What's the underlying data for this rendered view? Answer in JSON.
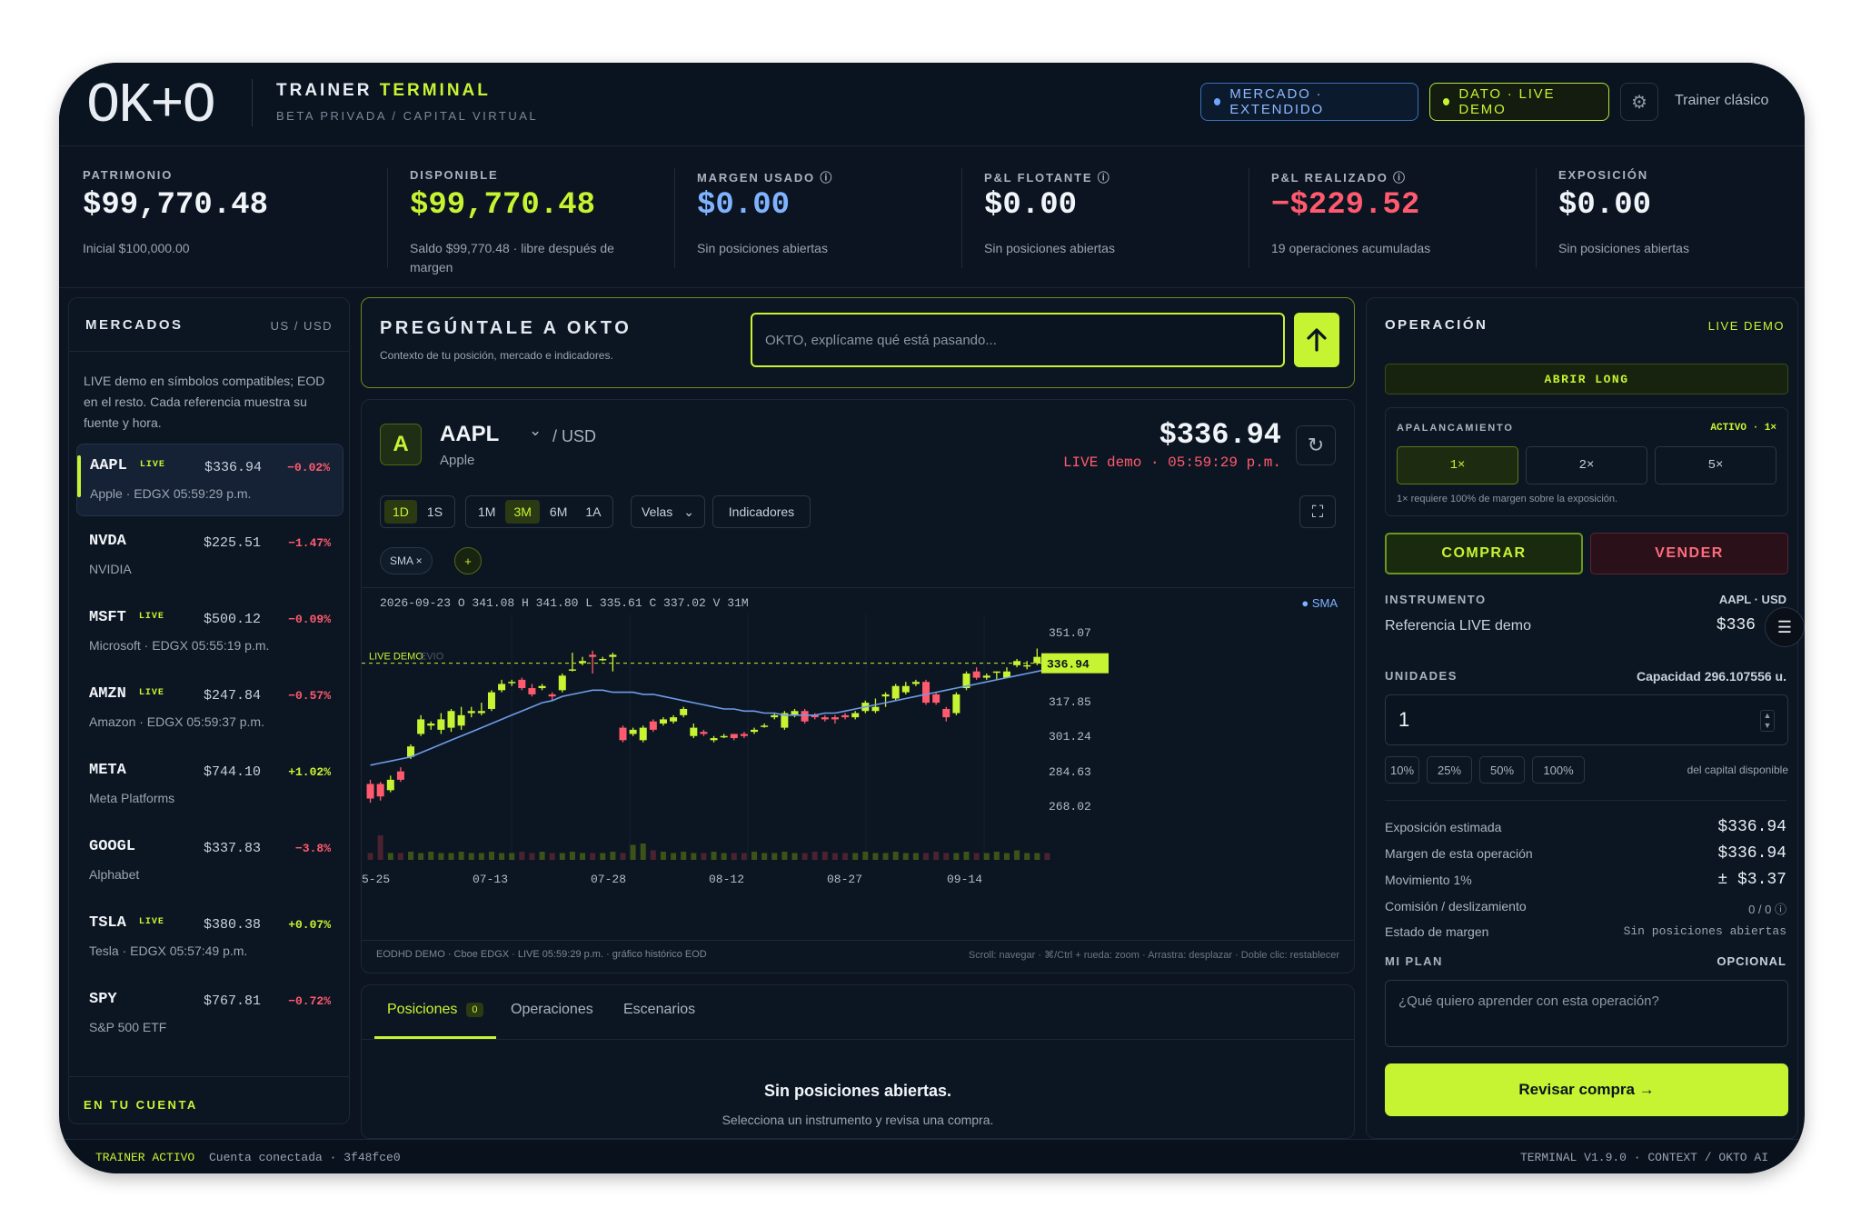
{
  "header": {
    "logo": "OK+O",
    "brand_a": "TRAINER",
    "brand_b": "TERMINAL",
    "subtitle": "BETA PRIVADA / CAPITAL VIRTUAL",
    "market_pill": "MERCADO · EXTENDIDO",
    "data_pill": "DATO · LIVE DEMO",
    "trainer_link": "Trainer clásico"
  },
  "stats": [
    {
      "label": "PATRIMONIO",
      "value": "$99,770.48",
      "sub": "Inicial $100,000.00",
      "color": "#f1f4f8"
    },
    {
      "label": "DISPONIBLE",
      "value": "$99,770.48",
      "sub": "Saldo $99,770.48 · libre después de margen",
      "color": "#c6f432"
    },
    {
      "label": "MARGEN USADO ⓘ",
      "value": "$0.00",
      "sub": "Sin posiciones abiertas",
      "color": "#7fb3ff"
    },
    {
      "label": "P&L FLOTANTE ⓘ",
      "value": "$0.00",
      "sub": "Sin posiciones abiertas",
      "color": "#f1f4f8"
    },
    {
      "label": "P&L REALIZADO ⓘ",
      "value": "−$229.52",
      "sub": "19 operaciones acumuladas",
      "color": "#ff5a6e"
    },
    {
      "label": "EXPOSICIÓN",
      "value": "$0.00",
      "sub": "Sin posiciones abiertas",
      "color": "#f1f4f8"
    }
  ],
  "markets": {
    "title": "MERCADOS",
    "region": "US / USD",
    "note": "LIVE demo en símbolos compatibles; EOD en el resto. Cada referencia muestra su fuente y hora.",
    "items": [
      {
        "symbol": "AAPL",
        "live": "LIVE",
        "price": "$336.94",
        "change": "−0.02%",
        "dir": "dn",
        "name": "Apple · EDGX 05:59:29 p.m."
      },
      {
        "symbol": "NVDA",
        "live": "",
        "price": "$225.51",
        "change": "−1.47%",
        "dir": "dn",
        "name": "NVIDIA"
      },
      {
        "symbol": "MSFT",
        "live": "LIVE",
        "price": "$500.12",
        "change": "−0.09%",
        "dir": "dn",
        "name": "Microsoft · EDGX 05:55:19 p.m."
      },
      {
        "symbol": "AMZN",
        "live": "LIVE",
        "price": "$247.84",
        "change": "−0.57%",
        "dir": "dn",
        "name": "Amazon · EDGX 05:59:37 p.m."
      },
      {
        "symbol": "META",
        "live": "",
        "price": "$744.10",
        "change": "+1.02%",
        "dir": "up",
        "name": "Meta Platforms"
      },
      {
        "symbol": "GOOGL",
        "live": "",
        "price": "$337.83",
        "change": "−3.8%",
        "dir": "dn",
        "name": "Alphabet"
      },
      {
        "symbol": "TSLA",
        "live": "LIVE",
        "price": "$380.38",
        "change": "+0.07%",
        "dir": "up",
        "name": "Tesla · EDGX 05:57:49 p.m."
      },
      {
        "symbol": "SPY",
        "live": "",
        "price": "$767.81",
        "change": "−0.72%",
        "dir": "dn",
        "name": "S&P 500 ETF"
      }
    ],
    "account_label": "EN TU CUENTA"
  },
  "ask": {
    "title": "PREGÚNTALE A OKTO",
    "subtitle": "Contexto de tu posición, mercado e indicadores.",
    "placeholder": "OKTO, explícame qué está pasando..."
  },
  "chart": {
    "badge": "A",
    "symbol": "AAPL",
    "currency": "/ USD",
    "company": "Apple",
    "price": "$336.94",
    "live_text": "LIVE demo · 05:59:29 p.m.",
    "ranges_a": [
      "1D",
      "1S"
    ],
    "ranges_b": [
      "1M",
      "3M",
      "6M",
      "1A"
    ],
    "active_range": "3M",
    "chart_style": "Velas",
    "indicators_label": "Indicadores",
    "sma_chip": "SMA ×",
    "add_chip": "+",
    "ohlc_readout": "2026-09-23 O 341.08 H 341.80 L 335.61 C 337.02 V 31M",
    "sma_legend": "● SMA",
    "live_line_label": "LIVE DEMO",
    "live_line_ghost": "EVIO",
    "price_tag": "336.94",
    "y_ticks": [
      "351.07",
      "317.85",
      "301.24",
      "284.63",
      "268.02"
    ],
    "x_ticks": [
      "5-25",
      "07-13",
      "07-28",
      "08-12",
      "08-27",
      "09-14"
    ],
    "source_note": "EODHD DEMO · Cboe EDGX · LIVE 05:59:29 p.m. · gráfico histórico EOD",
    "hint_note": "Scroll: navegar · ⌘/Ctrl + rueda: zoom · Arrastra: desplazar · Doble clic: restablecer"
  },
  "chart_data": {
    "type": "candlestick",
    "ylim": [
      260,
      356
    ],
    "y_ticks": [
      351.07,
      317.85,
      301.24,
      284.63,
      268.02
    ],
    "x_labels": [
      "5-25",
      "07-13",
      "07-28",
      "08-12",
      "08-27",
      "09-14"
    ],
    "live_price": 336.94,
    "candles": [
      [
        279,
        272,
        281,
        270
      ],
      [
        279,
        273,
        280,
        271
      ],
      [
        276,
        281,
        283,
        275
      ],
      [
        285,
        281,
        287,
        280
      ],
      [
        292,
        297,
        298,
        291
      ],
      [
        303,
        310,
        312,
        302
      ],
      [
        307,
        308,
        309,
        305
      ],
      [
        305,
        310,
        313,
        303
      ],
      [
        306,
        314,
        315,
        304
      ],
      [
        307,
        312,
        316,
        305
      ],
      [
        313,
        314,
        316,
        311
      ],
      [
        313,
        314,
        318,
        312
      ],
      [
        315,
        323,
        324,
        314
      ],
      [
        324,
        327,
        329,
        323
      ],
      [
        328,
        328,
        329,
        326
      ],
      [
        329,
        325,
        330,
        324
      ],
      [
        325,
        322,
        327,
        321
      ],
      [
        325,
        326,
        327,
        324
      ],
      [
        322,
        321,
        323,
        319
      ],
      [
        324,
        331,
        332,
        323
      ],
      [
        334,
        334,
        342,
        333
      ],
      [
        337,
        338,
        340,
        336
      ],
      [
        341,
        340,
        343,
        332
      ],
      [
        339,
        339,
        340,
        338
      ],
      [
        340,
        341,
        342,
        333
      ],
      [
        306,
        300,
        307,
        299
      ],
      [
        303,
        305,
        306,
        302
      ],
      [
        300,
        306,
        307,
        299
      ],
      [
        309,
        305,
        310,
        304
      ],
      [
        308,
        310,
        311,
        307
      ],
      [
        309,
        311,
        312,
        308
      ],
      [
        312,
        315,
        316,
        311
      ],
      [
        302,
        306,
        308,
        301
      ],
      [
        304,
        303,
        305,
        302
      ],
      [
        300,
        301,
        302,
        299
      ],
      [
        302,
        302,
        303,
        301
      ],
      [
        303,
        301,
        303,
        300
      ],
      [
        303,
        302,
        304,
        301
      ],
      [
        304,
        305,
        306,
        303
      ],
      [
        307,
        307,
        308,
        306
      ],
      [
        311,
        312,
        313,
        310
      ],
      [
        306,
        313,
        314,
        305
      ],
      [
        312,
        314,
        315,
        311
      ],
      [
        314,
        309,
        315,
        308
      ],
      [
        312,
        311,
        313,
        310
      ],
      [
        311,
        310,
        312,
        309
      ],
      [
        311,
        310,
        312,
        308
      ],
      [
        312,
        311,
        313,
        310
      ],
      [
        311,
        313,
        314,
        310
      ],
      [
        314,
        318,
        319,
        313
      ],
      [
        314,
        316,
        320,
        313
      ],
      [
        321,
        322,
        323,
        316
      ],
      [
        320,
        326,
        327,
        319
      ],
      [
        323,
        326,
        328,
        322
      ],
      [
        327,
        328,
        329,
        326
      ],
      [
        328,
        318,
        329,
        317
      ],
      [
        322,
        318,
        323,
        317
      ],
      [
        315,
        311,
        316,
        309
      ],
      [
        313,
        322,
        323,
        312
      ],
      [
        325,
        332,
        333,
        324
      ],
      [
        333,
        330,
        335,
        329
      ],
      [
        330,
        331,
        332,
        329
      ],
      [
        333,
        333,
        333,
        329
      ],
      [
        330,
        333,
        335,
        330
      ],
      [
        336,
        338,
        339,
        335
      ],
      [
        336,
        336,
        338,
        334
      ],
      [
        337,
        340,
        344,
        336
      ],
      [
        340,
        337,
        341,
        336
      ]
    ],
    "sma": [
      288,
      289,
      290,
      291,
      292,
      294,
      296,
      298,
      300,
      302,
      304,
      306,
      308,
      310,
      312,
      314,
      316,
      318,
      319,
      321,
      322,
      323,
      324,
      324,
      323,
      323,
      323,
      322,
      322,
      321,
      320,
      319,
      318,
      317,
      316,
      315,
      315,
      314,
      314,
      313,
      313,
      312,
      312,
      312,
      312,
      313,
      313,
      314,
      315,
      316,
      317,
      318,
      319,
      320,
      321,
      322,
      323,
      324,
      325,
      326,
      327,
      328,
      329,
      330,
      331,
      332,
      333,
      334
    ],
    "volume": [
      0.25,
      0.9,
      0.25,
      0.25,
      0.3,
      0.25,
      0.3,
      0.25,
      0.25,
      0.3,
      0.25,
      0.25,
      0.3,
      0.25,
      0.25,
      0.3,
      0.25,
      0.3,
      0.25,
      0.25,
      0.3,
      0.25,
      0.25,
      0.25,
      0.3,
      0.25,
      0.55,
      0.6,
      0.35,
      0.3,
      0.25,
      0.3,
      0.25,
      0.25,
      0.3,
      0.25,
      0.25,
      0.25,
      0.3,
      0.25,
      0.25,
      0.3,
      0.25,
      0.25,
      0.3,
      0.3,
      0.25,
      0.25,
      0.25,
      0.3,
      0.25,
      0.25,
      0.3,
      0.25,
      0.25,
      0.25,
      0.3,
      0.25,
      0.25,
      0.3,
      0.25,
      0.25,
      0.3,
      0.25,
      0.35,
      0.25,
      0.25,
      0.25
    ]
  },
  "positions": {
    "tabs": [
      {
        "label": "Posiciones",
        "count": "0"
      },
      {
        "label": "Operaciones",
        "count": ""
      },
      {
        "label": "Escenarios",
        "count": ""
      }
    ],
    "empty_title": "Sin posiciones abiertas.",
    "empty_sub": "Selecciona un instrumento y revisa una compra."
  },
  "operation": {
    "title": "OPERACIÓN",
    "mode": "LIVE DEMO",
    "action_banner": "ABRIR LONG",
    "leverage_label": "APALANCAMIENTO",
    "leverage_status": "ACTIVO · 1×",
    "leverage_options": [
      "1×",
      "2×",
      "5×"
    ],
    "leverage_note": "1× requiere 100% de margen sobre la exposición.",
    "buy": "COMPRAR",
    "sell": "VENDER",
    "instrument_label": "INSTRUMENTO",
    "instrument_value": "AAPL · USD",
    "reference_label": "Referencia LIVE demo",
    "reference_value": "$336",
    "units_label": "UNIDADES",
    "capacity": "Capacidad 296.107556 u.",
    "units_value": "1",
    "pct_buttons": [
      "10%",
      "25%",
      "50%",
      "100%"
    ],
    "pct_note": "del capital disponible",
    "rows": [
      {
        "k": "Exposición estimada",
        "v": "$336.94"
      },
      {
        "k": "Margen de esta operación",
        "v": "$336.94"
      },
      {
        "k": "Movimiento 1%",
        "v": "± $3.37"
      },
      {
        "k": "Comisión / deslizamiento",
        "v": "0 / 0 ⓘ"
      },
      {
        "k": "Estado de margen",
        "v": "Sin posiciones abiertas"
      }
    ],
    "plan_label": "MI PLAN",
    "plan_optional": "OPCIONAL",
    "plan_placeholder": "¿Qué quiero aprender con esta operación?",
    "submit": "Revisar compra →"
  },
  "footer": {
    "status": "TRAINER ACTIVO",
    "account": "Cuenta conectada · 3f48fce0",
    "version": "TERMINAL V1.9.0 · CONTEXT / OKTO AI"
  },
  "colors": {
    "accent": "#c6f432",
    "down": "#ff5a6e",
    "blue": "#7fb3ff",
    "bg": "#0b1420"
  }
}
